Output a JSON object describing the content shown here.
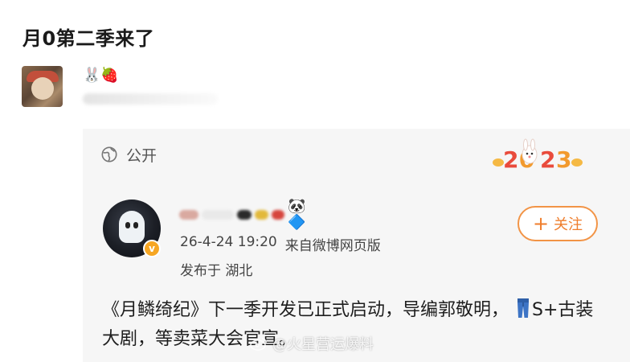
{
  "post": {
    "title": "月0第二季来了",
    "poster_emojis": "🐰🍓"
  },
  "card": {
    "visibility_label": "公开",
    "year_badge_icon": "rabbit-2023-badge",
    "author": {
      "name_emojis": "🐼🔷",
      "verified_mark": "v"
    },
    "meta": {
      "timestamp": "26-4-24 19:20",
      "source": "来自微博网页版",
      "location": "发布于 湖北"
    },
    "follow_button": {
      "plus": "+",
      "label": "关注"
    },
    "body": {
      "text_before_icon": "《月鳞绮纪》下一季开发已正式启动，导编郭敬明，",
      "text_after_icon": "S+古装大剧，等卖菜大会官宣。"
    }
  },
  "watermark": {
    "text": "@火星营运爆料"
  },
  "colors": {
    "accent": "#f29446",
    "card_bg": "#f6f6f6",
    "verified": "#f6a623"
  }
}
